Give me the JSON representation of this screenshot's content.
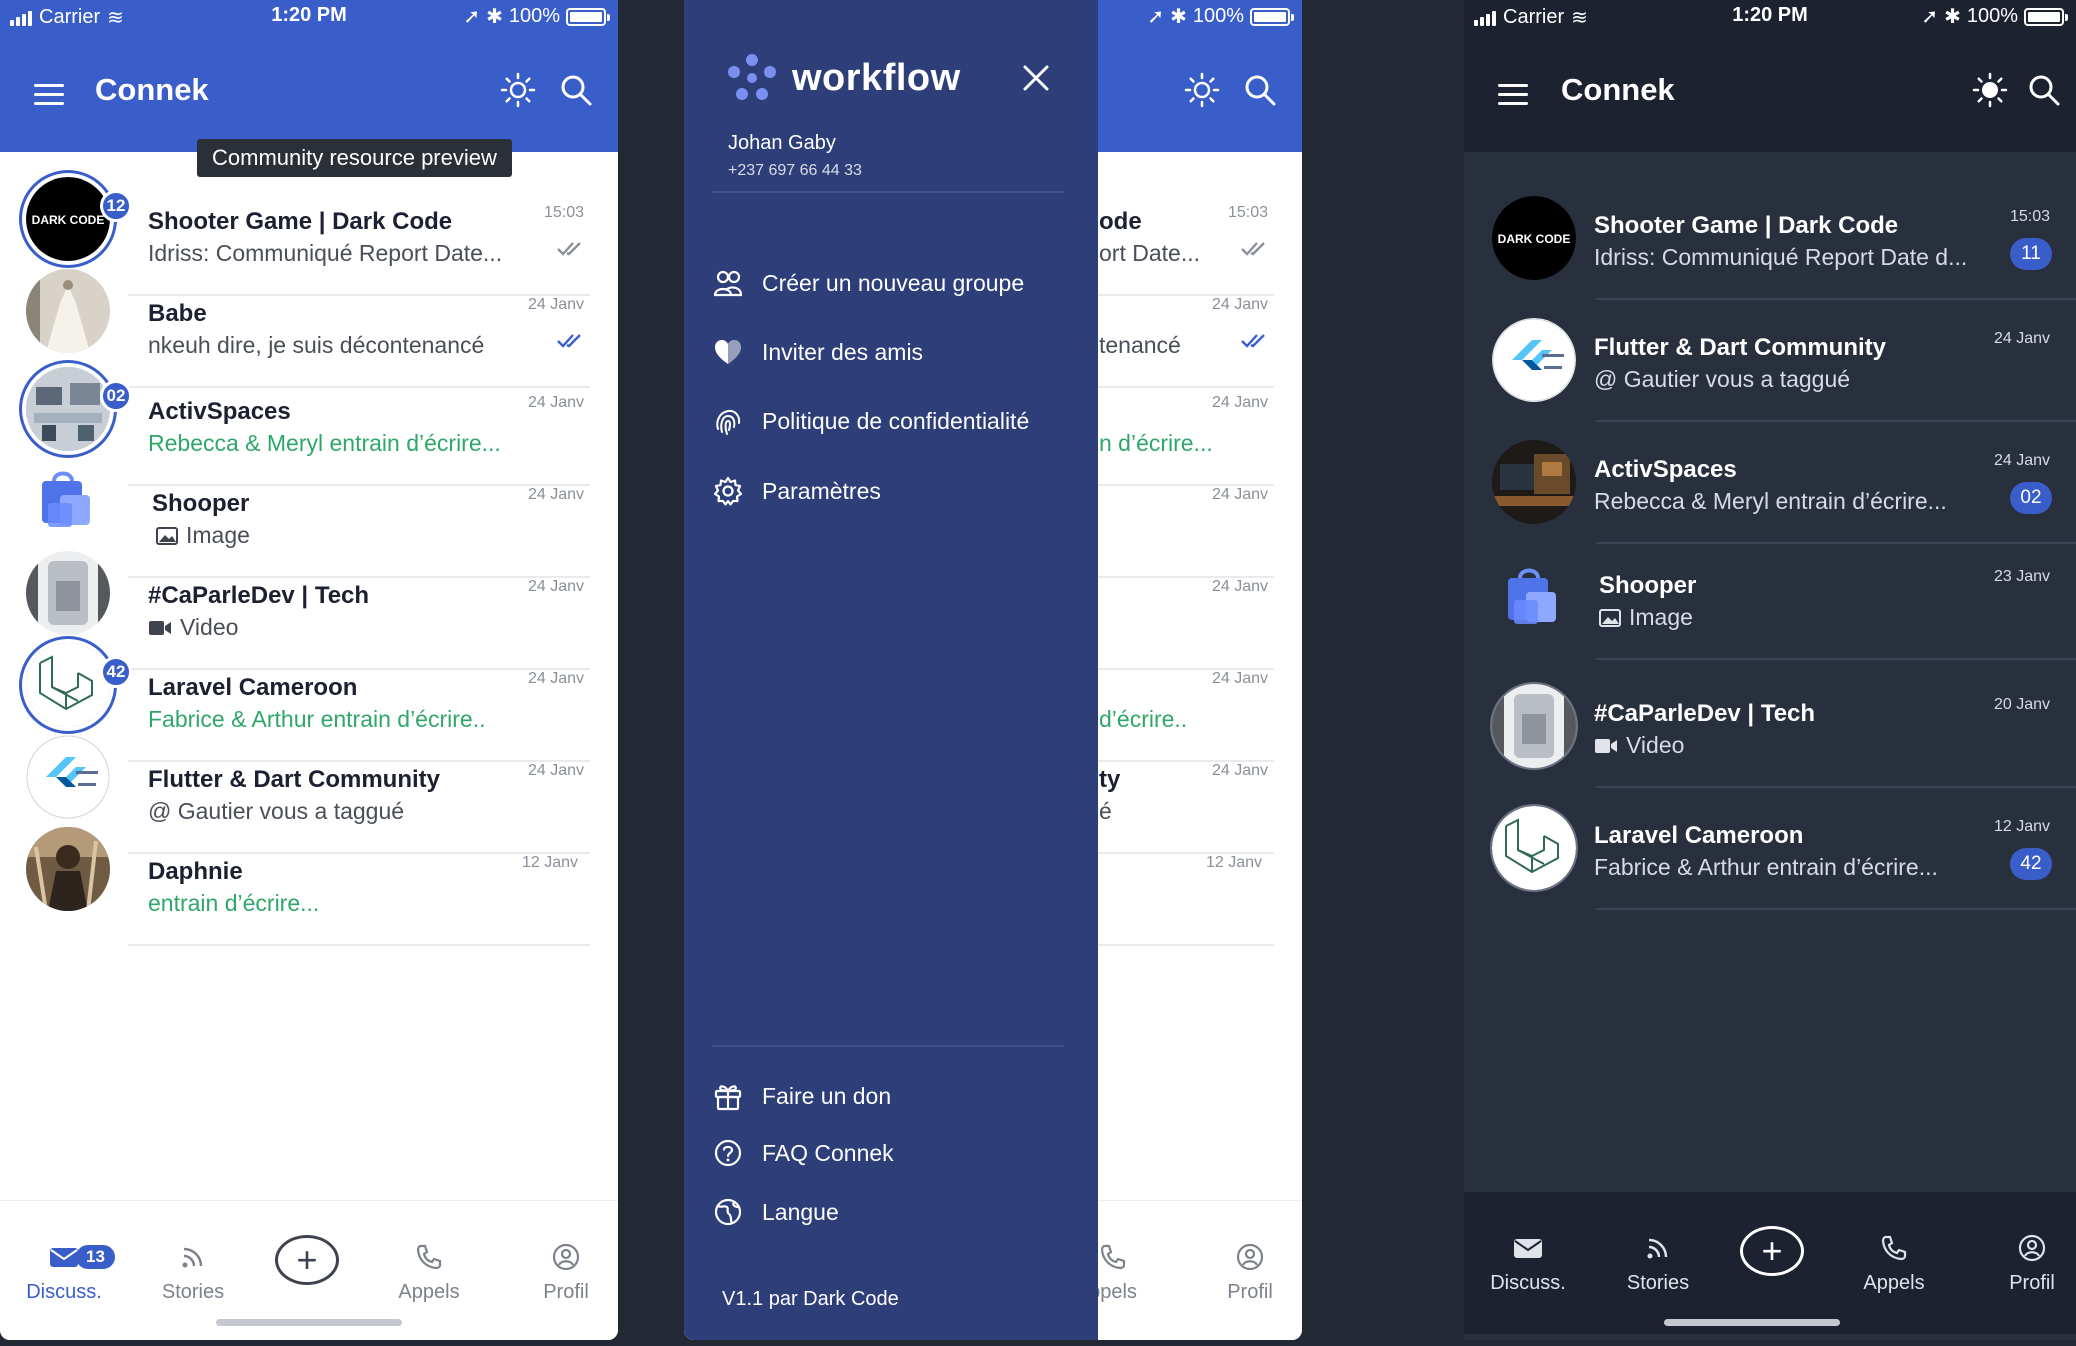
{
  "status": {
    "carrier": "Carrier",
    "time": "1:20 PM",
    "battery": "100%"
  },
  "app": {
    "title": "Connek"
  },
  "tooltip": "Community resource preview",
  "light_chats": [
    {
      "name": "Shooter Game | Dark Code",
      "message": "Idriss: Communiqué Report Date...",
      "date": "15:03",
      "badge": "12",
      "status": "read-grey",
      "avatar": "darkcode",
      "typing": false
    },
    {
      "name": "Babe",
      "message": "nkeuh dire, je suis décontenancé",
      "date": "24 Janv",
      "badge": "",
      "status": "read-blue",
      "avatar": "photo-dress",
      "typing": false
    },
    {
      "name": "ActivSpaces",
      "message": "Rebecca & Meryl entrain d’écrire...",
      "date": "24 Janv",
      "badge": "02",
      "status": "",
      "avatar": "photo-office",
      "typing": true
    },
    {
      "name": "Shooper",
      "message": "Image",
      "date": "24 Janv",
      "badge": "",
      "status": "",
      "avatar": "shopping-bag",
      "typing": false,
      "media": "image"
    },
    {
      "name": "#CaParleDev | Tech",
      "message": "Video",
      "date": "24 Janv",
      "badge": "",
      "status": "",
      "avatar": "photo-device",
      "typing": false,
      "media": "video"
    },
    {
      "name": "Laravel Cameroon",
      "message": "Fabrice & Arthur entrain d’écrire..",
      "date": "24 Janv",
      "badge": "42",
      "status": "",
      "avatar": "laravel",
      "typing": true
    },
    {
      "name": "Flutter & Dart Community",
      "message": "@ Gautier vous a taggué",
      "date": "24 Janv",
      "badge": "",
      "status": "",
      "avatar": "flutter",
      "typing": false
    },
    {
      "name": "Daphnie",
      "message": "entrain d’écrire...",
      "date": "12 Janv",
      "badge": "",
      "status": "",
      "avatar": "photo-person",
      "typing": true
    }
  ],
  "dark_chats": [
    {
      "name": "Shooter Game | Dark Code",
      "message": "Idriss: Communiqué Report Date d...",
      "date": "15:03",
      "count": "11",
      "avatar": "darkcode"
    },
    {
      "name": "Flutter & Dart Community",
      "message": "@ Gautier vous a taggué",
      "date": "24 Janv",
      "count": "",
      "avatar": "flutter"
    },
    {
      "name": "ActivSpaces",
      "message": "Rebecca & Meryl entrain d’écrire...",
      "date": "24 Janv",
      "count": "02",
      "avatar": "photo-desk"
    },
    {
      "name": "Shooper",
      "message": "Image",
      "date": "23 Janv",
      "count": "",
      "avatar": "shopping-bag",
      "media": "image"
    },
    {
      "name": "#CaParleDev | Tech",
      "message": "Video",
      "date": "20 Janv",
      "count": "",
      "avatar": "photo-device",
      "media": "video"
    },
    {
      "name": "Laravel Cameroon",
      "message": "Fabrice & Arthur entrain d’écrire...",
      "date": "12 Janv",
      "count": "42",
      "avatar": "laravel"
    }
  ],
  "partial_chats": [
    {
      "name": "ode",
      "message": "ort Date...",
      "date": "15:03",
      "status": "read-grey"
    },
    {
      "name": "",
      "message": "tenancé",
      "date": "24 Janv",
      "status": "read-blue"
    },
    {
      "name": "",
      "message": "n d’écrire...",
      "date": "24 Janv",
      "typing": true
    },
    {
      "name": "",
      "message": "",
      "date": "24 Janv"
    },
    {
      "name": "",
      "message": "",
      "date": "24 Janv"
    },
    {
      "name": "",
      "message": "d’écrire..",
      "date": "24 Janv",
      "typing": true
    },
    {
      "name": "ty",
      "message": "é",
      "date": "24 Janv"
    },
    {
      "name": "",
      "message": "",
      "date": "12 Janv"
    }
  ],
  "nav": {
    "discuss": "Discuss.",
    "discuss_badge": "13",
    "stories": "Stories",
    "calls": "Appels",
    "profile": "Profil",
    "calls_partial": "ppels"
  },
  "drawer": {
    "brand": "workflow",
    "user_name": "Johan Gaby",
    "user_phone": "+237 697 66 44 33",
    "items": [
      "Créer un nouveau groupe",
      "Inviter des amis",
      "Politique de confidentialité",
      "Paramètres"
    ],
    "footer_items": [
      "Faire un don",
      "FAQ Connek",
      "Langue"
    ],
    "version": "V1.1 par Dark Code"
  },
  "colors": {
    "primary": "#3a5ec9",
    "drawer": "#2d3e78",
    "dark_bg": "#282f3d",
    "typing": "#2fa76a"
  }
}
